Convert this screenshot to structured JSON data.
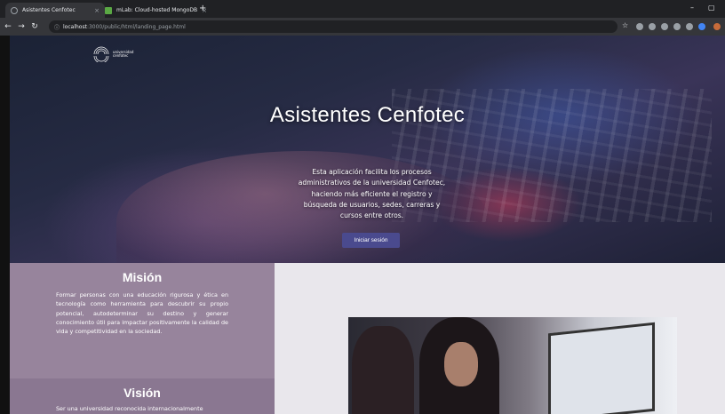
{
  "browser": {
    "tabs": [
      {
        "title": "Asistentes Cenfotec",
        "active": true
      },
      {
        "title": "mLab: Cloud-hosted MongoDB",
        "active": false
      }
    ],
    "new_tab": "+",
    "close_glyph": "×",
    "url_host": "localhost",
    "url_path": ":3000/public/html/landing_page.html"
  },
  "logo": {
    "line1": "universidad",
    "line2": "cenfotec"
  },
  "hero": {
    "title": "Asistentes Cenfotec",
    "description": "Esta aplicación facilita los procesos administrativos de la universidad Cenfotec, haciendo más eficiente el registro y búsqueda de usuarios, sedes, carreras y cursos entre otros.",
    "login_label": "Iniciar sesión"
  },
  "mission": {
    "title": "Misión",
    "text": "Formar personas con una educación rigurosa y ética en tecnología como herramienta para descubrir su propio potencial, autodeterminar su destino y generar conocimiento útil para impactar positivamente la calidad de vida y competitividad en la sociedad."
  },
  "vision": {
    "title": "Visión",
    "text": "Ser una universidad reconocida internacionalmente"
  },
  "colors": {
    "accent_button": "#4a4a8e",
    "mission_bg": "#97849c",
    "vision_bg": "#8a7791"
  }
}
